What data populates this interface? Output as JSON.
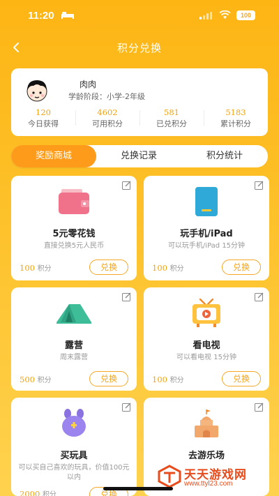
{
  "status_bar": {
    "time": "11:20",
    "battery": "100"
  },
  "nav": {
    "title": "积分兑换"
  },
  "profile": {
    "name": "肉肉",
    "grade_label": "学龄阶段：小学-2年级",
    "stats": [
      {
        "value": "120",
        "label": "今日获得"
      },
      {
        "value": "4602",
        "label": "可用积分"
      },
      {
        "value": "581",
        "label": "已兑积分"
      },
      {
        "value": "5183",
        "label": "累计积分"
      }
    ]
  },
  "tabs": [
    {
      "label": "奖励商城",
      "active": true
    },
    {
      "label": "兑换记录",
      "active": false
    },
    {
      "label": "积分统计",
      "active": false
    }
  ],
  "points_unit": "积分",
  "redeem_label": "兑换",
  "cards": [
    {
      "title": "5元零花钱",
      "desc": "直接兑换5元人民币",
      "points": "100",
      "icon": "wallet-icon"
    },
    {
      "title": "玩手机/iPad",
      "desc": "可以玩手机/iPad 15分钟",
      "points": "100",
      "icon": "tablet-icon"
    },
    {
      "title": "露营",
      "desc": "周末露营",
      "points": "500",
      "icon": "tent-icon"
    },
    {
      "title": "看电视",
      "desc": "可以看电视 15分钟",
      "points": "100",
      "icon": "tv-icon"
    },
    {
      "title": "买玩具",
      "desc": "可以买自己喜欢的玩具，价值100元以内",
      "points": "2000",
      "icon": "toy-icon"
    },
    {
      "title": "去游乐场",
      "desc": "",
      "points": "",
      "icon": "castle-icon"
    }
  ],
  "watermark": {
    "title": "天天游戏网",
    "url": "www.ttyl23.com"
  },
  "colors": {
    "accent": "#FF9B1A",
    "points": "#F2A30F",
    "background": "#FDB514"
  }
}
